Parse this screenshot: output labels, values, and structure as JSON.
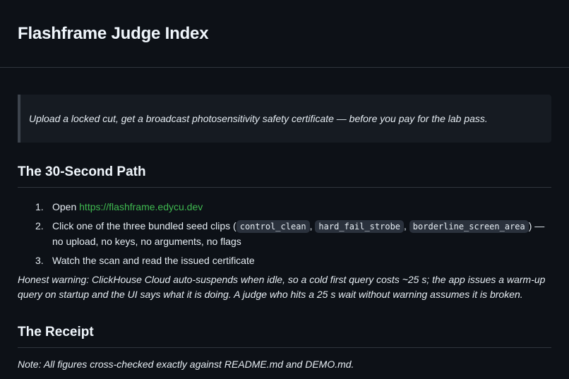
{
  "header": {
    "title": "Flashframe Judge Index"
  },
  "tagline": "Upload a locked cut, get a broadcast photosensitivity safety certificate — before you pay for the lab pass.",
  "path_section": {
    "heading": "The 30-Second Path",
    "steps": [
      {
        "num": "1.",
        "prefix": "Open ",
        "link": "https://flashframe.edycu.dev"
      },
      {
        "num": "2.",
        "prefix": "Click one of the three bundled seed clips (",
        "clips": [
          "control_clean",
          "hard_fail_strobe",
          "borderline_screen_area"
        ],
        "separator": ",",
        "suffix": ") — no upload, no keys, no arguments, no flags"
      },
      {
        "num": "3.",
        "text": "Watch the scan and read the issued certificate"
      }
    ],
    "warning": "Honest warning: ClickHouse Cloud auto-suspends when idle, so a cold first query costs ~25 s; the app issues a warm-up query on startup and the UI says what it is doing. A judge who hits a 25 s wait without warning assumes it is broken."
  },
  "receipt_section": {
    "heading": "The Receipt",
    "note": "Note: All figures cross-checked exactly against README.md and DEMO.md."
  }
}
